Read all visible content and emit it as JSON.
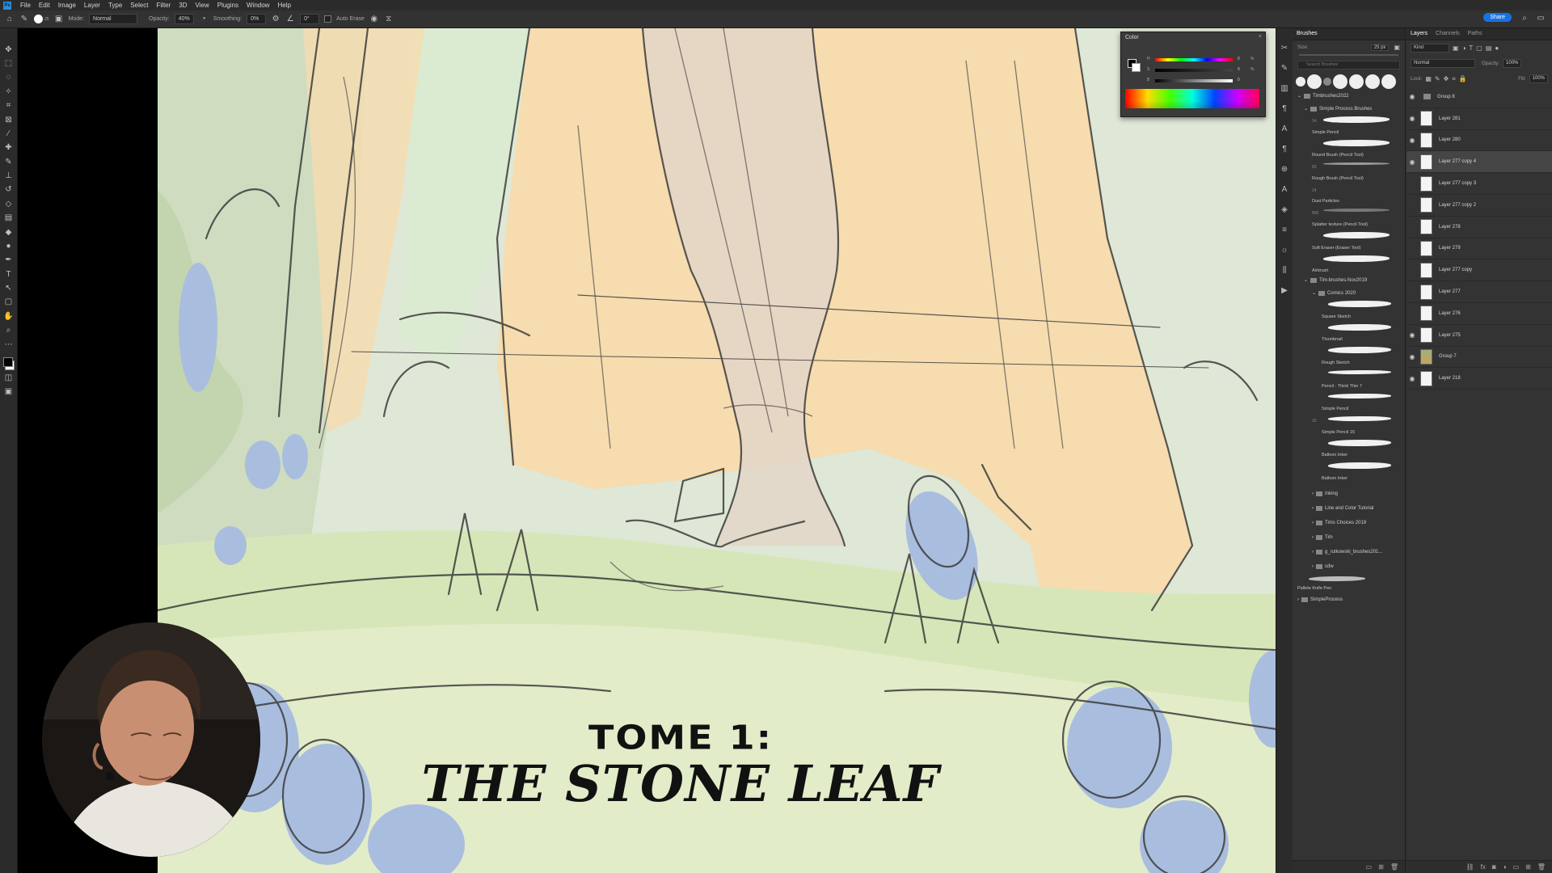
{
  "app": {
    "menu": [
      "File",
      "Edit",
      "Image",
      "Layer",
      "Type",
      "Select",
      "Filter",
      "3D",
      "View",
      "Plugins",
      "Window",
      "Help"
    ],
    "share_label": "Share"
  },
  "options_bar": {
    "mode_label": "Mode:",
    "mode_value": "Normal",
    "opacity_label": "Opacity:",
    "opacity_value": "40%",
    "smoothing_label": "Smoothing:",
    "smoothing_value": "0%",
    "angle_value": "0°",
    "auto_erase_label": "Auto Erase",
    "brush_size_value": "25"
  },
  "tools": [
    "move-tool",
    "marquee-tool",
    "lasso-tool",
    "magic-wand-tool",
    "crop-tool",
    "frame-tool",
    "eyedropper-tool",
    "healing-tool",
    "brush-tool",
    "stamp-tool",
    "history-brush-tool",
    "eraser-tool",
    "gradient-tool",
    "blur-tool",
    "dodge-tool",
    "pen-tool",
    "type-tool",
    "path-select-tool",
    "shape-tool",
    "hand-tool",
    "zoom-tool",
    "more-tools"
  ],
  "artwork": {
    "title_line1": "TOME 1:",
    "title_line2": "THE STONE LEAF"
  },
  "color_panel": {
    "title": "Color",
    "h_label": "H",
    "h_value": "0",
    "s_label": "S",
    "s_value": "0",
    "b_label": "B",
    "b_value": "0",
    "pct": "%"
  },
  "brushes_panel": {
    "tab": "Brushes",
    "size_label": "Size:",
    "size_value": "25 px",
    "search_placeholder": "Search Brushes",
    "group_top": "Timbrushes2022",
    "subgroup_1": "Simple Process Brushes",
    "entries_1": [
      {
        "num": "14",
        "name": "Simple Pencil"
      },
      {
        "num": "",
        "name": "Round Brush (Pencil Tool)"
      },
      {
        "num": "83",
        "name": "Rough Brush (Pencil Tool)"
      },
      {
        "num": "14",
        "name": "Dust Particles"
      },
      {
        "num": "800",
        "name": "Splatter texture (Pencil Tool)"
      },
      {
        "num": "",
        "name": "Soft Eraser (Eraser Tool)"
      },
      {
        "num": "",
        "name": "Airbrush"
      }
    ],
    "group_2": "Tim-brushes-Nov2019",
    "subgroup_2": "Comics 2020",
    "entries_2": [
      {
        "num": "",
        "name": "Square Sketch"
      },
      {
        "num": "",
        "name": "Thumbnail"
      },
      {
        "num": "",
        "name": "Rough Sketch"
      },
      {
        "num": "",
        "name": "Pencil - Think Thin 7"
      },
      {
        "num": "",
        "name": "Simple Pencil"
      },
      {
        "num": "15",
        "name": "Simple Pencil 15"
      },
      {
        "num": "",
        "name": "Balloon Inker"
      },
      {
        "num": "",
        "name": "Balloon Inker"
      }
    ],
    "folders": [
      "Inking",
      "Line and Color Tutorial",
      "Tims Choices 2019",
      "Tim",
      "g_rutkowski_brushes201...",
      "cdw"
    ],
    "last_brush": "Pallete Knife Pen",
    "last_group": "SimpleProcess"
  },
  "layers_panel": {
    "tabs": [
      "Layers",
      "Channels",
      "Paths"
    ],
    "kind_label": "Kind",
    "blend_mode": "Normal",
    "opacity_label": "Opacity:",
    "opacity_value": "100%",
    "lock_label": "Lock:",
    "fill_label": "Fill:",
    "fill_value": "100%",
    "layers": [
      {
        "name": "Group 8",
        "visible": true,
        "type": "group"
      },
      {
        "name": "Layer 281",
        "visible": true,
        "type": "layer"
      },
      {
        "name": "Layer 280",
        "visible": true,
        "type": "layer"
      },
      {
        "name": "Layer 277 copy 4",
        "visible": true,
        "type": "layer",
        "selected": true
      },
      {
        "name": "Layer 277 copy 3",
        "visible": false,
        "type": "layer"
      },
      {
        "name": "Layer 277 copy 2",
        "visible": false,
        "type": "layer"
      },
      {
        "name": "Layer 278",
        "visible": false,
        "type": "layer"
      },
      {
        "name": "Layer 279",
        "visible": false,
        "type": "layer"
      },
      {
        "name": "Layer 277 copy",
        "visible": false,
        "type": "layer"
      },
      {
        "name": "Layer 277",
        "visible": false,
        "type": "layer"
      },
      {
        "name": "Layer 276",
        "visible": false,
        "type": "layer"
      },
      {
        "name": "Layer 275",
        "visible": true,
        "type": "layer"
      },
      {
        "name": "Group 7",
        "visible": true,
        "type": "art"
      },
      {
        "name": "Layer 218",
        "visible": true,
        "type": "layer"
      }
    ]
  },
  "colors": {
    "accent": "#1473e6",
    "cape": "#f6dcae",
    "foliage": "#cfe0b4",
    "leaf_blue": "#a9bddf",
    "ground": "#d7e6b8"
  }
}
